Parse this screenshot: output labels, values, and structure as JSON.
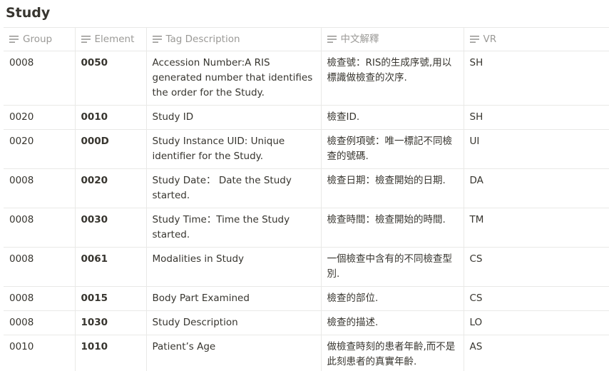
{
  "page": {
    "title": "Study"
  },
  "table": {
    "headers": {
      "group": "Group",
      "element": "Element",
      "tag": "Tag Description",
      "zh": "中文解釋",
      "vr": "VR"
    },
    "rows": [
      {
        "group": "0008",
        "element": "0050",
        "tag": "Accession Number:A RIS generated number that identifies the order for the Study.",
        "zh": "檢查號：RIS的生成序號,用以標識做檢查的次序.",
        "vr": "SH"
      },
      {
        "group": "0020",
        "element": "0010",
        "tag": "Study ID",
        "zh": "檢查ID.",
        "vr": "SH"
      },
      {
        "group": "0020",
        "element": "000D",
        "tag": "Study Instance UID: Unique identifier for the Study.",
        "zh": "檢查例項號：唯一標記不同檢查的號碼.",
        "vr": "UI"
      },
      {
        "group": "0008",
        "element": "0020",
        "tag": "Study Date：  Date the Study started.",
        "zh": "檢查日期：檢查開始的日期.",
        "vr": "DA"
      },
      {
        "group": "0008",
        "element": "0030",
        "tag": "Study Time：Time the Study started.",
        "zh": "檢查時間：檢查開始的時間.",
        "vr": "TM"
      },
      {
        "group": "0008",
        "element": "0061",
        "tag": "Modalities in Study",
        "zh": "一個檢查中含有的不同檢查型別.",
        "vr": "CS"
      },
      {
        "group": "0008",
        "element": "0015",
        "tag": "Body Part Examined",
        "zh": "檢查的部位.",
        "vr": "CS"
      },
      {
        "group": "0008",
        "element": "1030",
        "tag": "Study Description",
        "zh": "檢查的描述.",
        "vr": "LO"
      },
      {
        "group": "0010",
        "element": "1010",
        "tag": "Patient’s Age",
        "zh": "做檢查時刻的患者年齡,而不是此刻患者的真實年齡.",
        "vr": "AS"
      }
    ]
  },
  "icons": {
    "column_type": "text-lines-icon"
  },
  "colors": {
    "text": "#37352f",
    "header_text": "#9b9a97",
    "border": "#e9e9e7"
  }
}
